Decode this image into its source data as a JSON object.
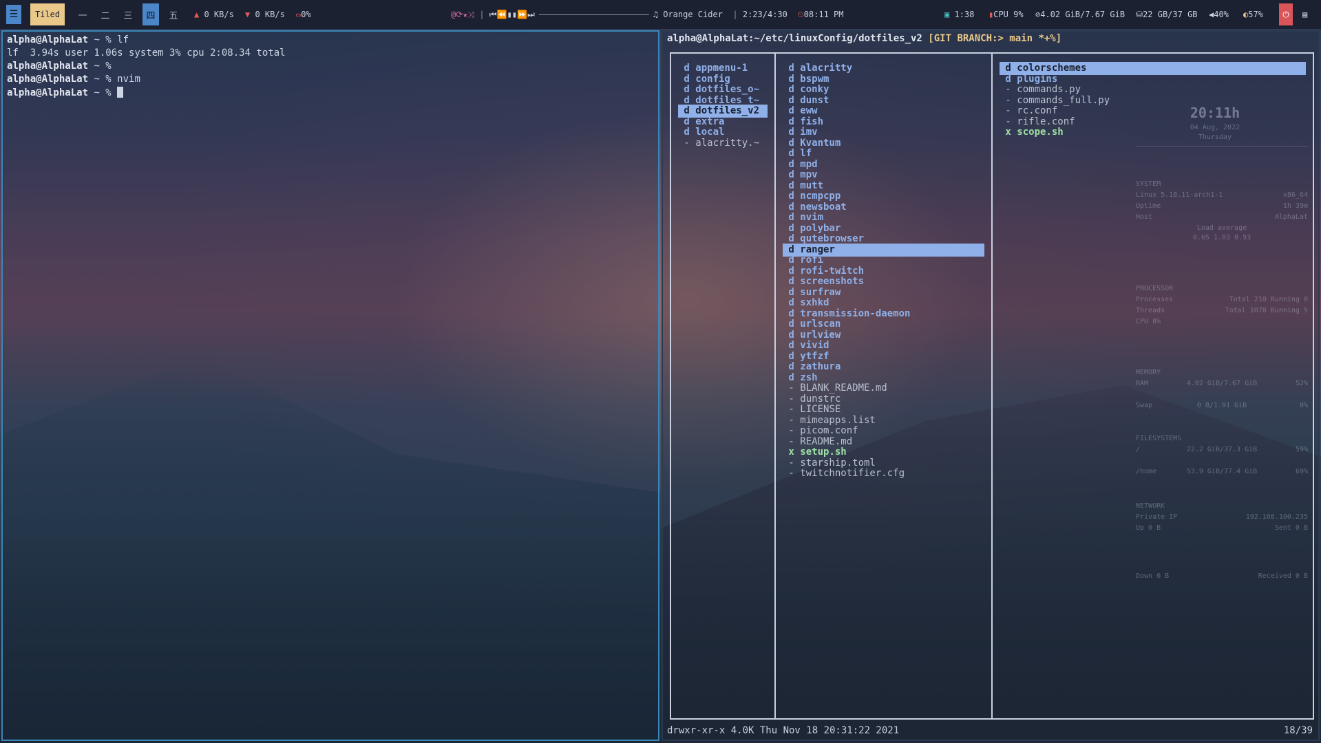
{
  "topbar": {
    "menu_icon": "menu-icon",
    "layout_label": "Tiled",
    "workspaces": [
      "一",
      "二",
      "三",
      "四",
      "五"
    ],
    "net_up": "0 KB/s",
    "net_down": "0 KB/s",
    "disk_io": "0%",
    "player_icons": "@⟳★⤨",
    "player_controls": "⏮⏪▮▮⏩⏭",
    "song": "Orange Cider",
    "song_time": "2:23/4:30",
    "clock": "08:11 PM",
    "uptime": "1:38",
    "cpu": "CPU 9%",
    "ram": "4.02 GiB/7.67 GiB",
    "disk": "22 GB/37 GB",
    "volume": "40%",
    "brightness": "57%"
  },
  "left_terminal": {
    "lines": [
      {
        "prompt": "alpha@AlphaLat",
        "rest": " ~ % lf"
      },
      {
        "prompt": "",
        "rest": "lf  3.94s user 1.06s system 3% cpu 2:08.34 total"
      },
      {
        "prompt": "alpha@AlphaLat",
        "rest": " ~ %"
      },
      {
        "prompt": "alpha@AlphaLat",
        "rest": " ~ % nvim"
      },
      {
        "prompt": "alpha@AlphaLat",
        "rest": " ~ % "
      }
    ]
  },
  "right_terminal": {
    "prompt": "alpha@AlphaLat:~/etc/linuxConfig/dotfiles_v2 ",
    "branch": "[GIT BRANCH:> main *+%]",
    "parent_col": [
      {
        "t": "d",
        "name": "appmenu-1",
        "kind": "dir"
      },
      {
        "t": "d",
        "name": "config",
        "kind": "dir"
      },
      {
        "t": "d",
        "name": "dotfiles_o~",
        "kind": "dir"
      },
      {
        "t": "d",
        "name": "dotfiles_t~",
        "kind": "dir"
      },
      {
        "t": "d",
        "name": "dotfiles_v2",
        "kind": "dir",
        "selected": true
      },
      {
        "t": "d",
        "name": "extra",
        "kind": "dir"
      },
      {
        "t": "d",
        "name": "local",
        "kind": "dir"
      },
      {
        "t": "-",
        "name": "alacritty.~",
        "kind": "file"
      }
    ],
    "current_col": [
      {
        "t": "d",
        "name": "alacritty",
        "kind": "dir"
      },
      {
        "t": "d",
        "name": "bspwm",
        "kind": "dir"
      },
      {
        "t": "d",
        "name": "conky",
        "kind": "dir"
      },
      {
        "t": "d",
        "name": "dunst",
        "kind": "dir"
      },
      {
        "t": "d",
        "name": "eww",
        "kind": "dir"
      },
      {
        "t": "d",
        "name": "fish",
        "kind": "dir"
      },
      {
        "t": "d",
        "name": "imv",
        "kind": "dir"
      },
      {
        "t": "d",
        "name": "Kvantum",
        "kind": "dir"
      },
      {
        "t": "d",
        "name": "lf",
        "kind": "dir"
      },
      {
        "t": "d",
        "name": "mpd",
        "kind": "dir"
      },
      {
        "t": "d",
        "name": "mpv",
        "kind": "dir"
      },
      {
        "t": "d",
        "name": "mutt",
        "kind": "dir"
      },
      {
        "t": "d",
        "name": "ncmpcpp",
        "kind": "dir"
      },
      {
        "t": "d",
        "name": "newsboat",
        "kind": "dir"
      },
      {
        "t": "d",
        "name": "nvim",
        "kind": "dir"
      },
      {
        "t": "d",
        "name": "polybar",
        "kind": "dir"
      },
      {
        "t": "d",
        "name": "qutebrowser",
        "kind": "dir"
      },
      {
        "t": "d",
        "name": "ranger",
        "kind": "dir",
        "selected": true
      },
      {
        "t": "d",
        "name": "rofi",
        "kind": "dir"
      },
      {
        "t": "d",
        "name": "rofi-twitch",
        "kind": "dir"
      },
      {
        "t": "d",
        "name": "screenshots",
        "kind": "dir"
      },
      {
        "t": "d",
        "name": "surfraw",
        "kind": "dir"
      },
      {
        "t": "d",
        "name": "sxhkd",
        "kind": "dir"
      },
      {
        "t": "d",
        "name": "transmission-daemon",
        "kind": "dir"
      },
      {
        "t": "d",
        "name": "urlscan",
        "kind": "dir"
      },
      {
        "t": "d",
        "name": "urlview",
        "kind": "dir"
      },
      {
        "t": "d",
        "name": "vivid",
        "kind": "dir"
      },
      {
        "t": "d",
        "name": "ytfzf",
        "kind": "dir"
      },
      {
        "t": "d",
        "name": "zathura",
        "kind": "dir"
      },
      {
        "t": "d",
        "name": "zsh",
        "kind": "dir"
      },
      {
        "t": "-",
        "name": "BLANK_README.md",
        "kind": "file"
      },
      {
        "t": "-",
        "name": "dunstrc",
        "kind": "file"
      },
      {
        "t": "-",
        "name": "LICENSE",
        "kind": "file"
      },
      {
        "t": "-",
        "name": "mimeapps.list",
        "kind": "file"
      },
      {
        "t": "-",
        "name": "picom.conf",
        "kind": "file"
      },
      {
        "t": "-",
        "name": "README.md",
        "kind": "file"
      },
      {
        "t": "x",
        "name": "setup.sh",
        "kind": "exec"
      },
      {
        "t": "-",
        "name": "starship.toml",
        "kind": "file"
      },
      {
        "t": "-",
        "name": "twitchnotifier.cfg",
        "kind": "file"
      }
    ],
    "preview_col": [
      {
        "t": "d",
        "name": "colorschemes",
        "kind": "dir",
        "selected": true
      },
      {
        "t": "d",
        "name": "plugins",
        "kind": "dir"
      },
      {
        "t": "-",
        "name": "commands.py",
        "kind": "file"
      },
      {
        "t": "-",
        "name": "commands_full.py",
        "kind": "file"
      },
      {
        "t": "-",
        "name": "rc.conf",
        "kind": "file"
      },
      {
        "t": "-",
        "name": "rifle.conf",
        "kind": "file"
      },
      {
        "t": "x",
        "name": "scope.sh",
        "kind": "exec"
      }
    ],
    "status": "drwxr-xr-x 4.0K Thu Nov 18 20:31:22 2021",
    "position": "18/39"
  },
  "conky": {
    "time": "20:11h",
    "date": "04 Aug, 2022",
    "day": "Thursday",
    "system_header": "SYSTEM",
    "kernel": "Linux 5.18.11-arch1-1",
    "arch": "x86_64",
    "uptime_label": "Uptime",
    "uptime": "1h 39m",
    "host_label": "Host",
    "host": "AlphaLat",
    "load_label": "Load average",
    "load": "0.65 1.03 0.93",
    "processor_header": "PROCESSOR",
    "processes_label": "Processes",
    "processes": "Total 210  Running 0",
    "threads_label": "Threads",
    "threads": "Total 1078  Running 5",
    "cpu_label": "CPU  8%",
    "memory_header": "MEMORY",
    "ram_label": "RAM",
    "ram": "4.02 GiB/7.67 GiB",
    "ram_pct": "52%",
    "swap_label": "Swap",
    "swap": "0 B/1.91 GiB",
    "swap_pct": "0%",
    "fs_header": "FILESYSTEMS",
    "root_label": "/",
    "root": "22.2 GiB/37.3 GiB",
    "root_pct": "59%",
    "home_label": "/home",
    "home": "53.9 GiB/77.4 GiB",
    "home_pct": "69%",
    "network_header": "NETWORK",
    "ip_label": "Private IP",
    "ip": "192.168.100.235",
    "up": "Up 0 B",
    "sent": "Sent 0 B",
    "down": "Down 0 B",
    "received": "Received 0 B"
  }
}
